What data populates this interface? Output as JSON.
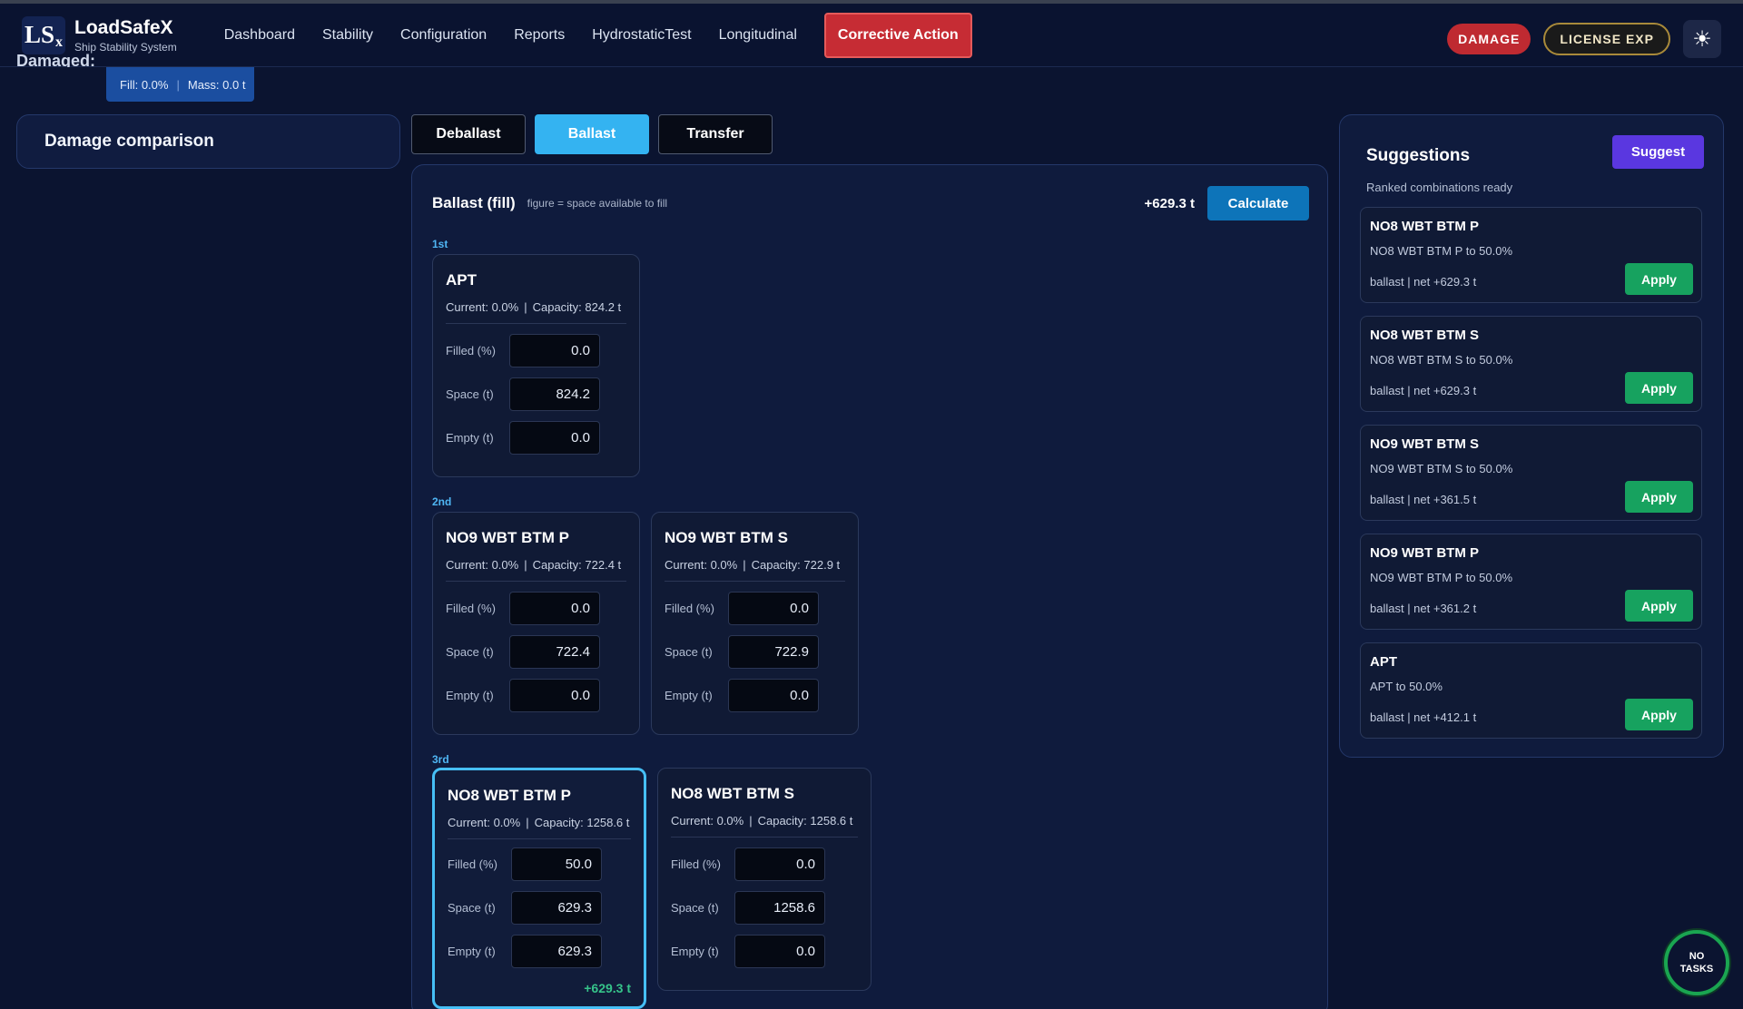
{
  "app": {
    "logo_mark": "LS",
    "logo_mark_x": "x",
    "name": "LoadSafeX",
    "subtitle": "Ship Stability System"
  },
  "nav": {
    "items": [
      "Dashboard",
      "Stability",
      "Configuration",
      "Reports",
      "HydrostaticTest",
      "Longitudinal"
    ],
    "active": "Corrective Action"
  },
  "top_right": {
    "damage_label": "DAMAGE",
    "license_label": "LICENSE EXP",
    "theme_icon": "sun-icon",
    "theme_glyph": "☀"
  },
  "damaged": {
    "label": "Damaged:",
    "fill": "Fill: 0.0%",
    "mass": "Mass: 0.0 t"
  },
  "left_panel": {
    "title": "Damage comparison"
  },
  "mode_tabs": [
    {
      "label": "Deballast",
      "active": false
    },
    {
      "label": "Ballast",
      "active": true
    },
    {
      "label": "Transfer",
      "active": false
    }
  ],
  "main": {
    "title": "Ballast (fill)",
    "hint": "figure = space available to fill",
    "net": "+629.3 t",
    "calculate_label": "Calculate"
  },
  "groups": [
    {
      "label": "1st",
      "tanks": [
        {
          "name": "APT",
          "current": "Current: 0.0%",
          "capacity": "Capacity: 824.2 t",
          "filled": "0.0",
          "space": "824.2",
          "empty": "0.0",
          "net": "",
          "selected": false
        }
      ]
    },
    {
      "label": "2nd",
      "tanks": [
        {
          "name": "NO9 WBT BTM P",
          "current": "Current: 0.0%",
          "capacity": "Capacity: 722.4 t",
          "filled": "0.0",
          "space": "722.4",
          "empty": "0.0",
          "net": "",
          "selected": false
        },
        {
          "name": "NO9 WBT BTM S",
          "current": "Current: 0.0%",
          "capacity": "Capacity: 722.9 t",
          "filled": "0.0",
          "space": "722.9",
          "empty": "0.0",
          "net": "",
          "selected": false
        }
      ]
    },
    {
      "label": "3rd",
      "tanks": [
        {
          "name": "NO8 WBT BTM P",
          "current": "Current: 0.0%",
          "capacity": "Capacity: 1258.6 t",
          "filled": "50.0",
          "space": "629.3",
          "empty": "629.3",
          "net": "+629.3 t",
          "selected": true
        },
        {
          "name": "NO8 WBT BTM S",
          "current": "Current: 0.0%",
          "capacity": "Capacity: 1258.6 t",
          "filled": "0.0",
          "space": "1258.6",
          "empty": "0.0",
          "net": "",
          "selected": false
        }
      ]
    }
  ],
  "field_labels": {
    "filled": "Filled (%)",
    "space": "Space (t)",
    "empty": "Empty (t)"
  },
  "suggestions": {
    "title": "Suggestions",
    "suggest_label": "Suggest",
    "status": "Ranked combinations ready",
    "apply_label": "Apply",
    "items": [
      {
        "name": "NO8 WBT BTM P",
        "desc": "NO8 WBT BTM P to 50.0%",
        "detail": "ballast | net +629.3 t"
      },
      {
        "name": "NO8 WBT BTM S",
        "desc": "NO8 WBT BTM S to 50.0%",
        "detail": "ballast | net +629.3 t"
      },
      {
        "name": "NO9 WBT BTM S",
        "desc": "NO9 WBT BTM S to 50.0%",
        "detail": "ballast | net +361.5 t"
      },
      {
        "name": "NO9 WBT BTM P",
        "desc": "NO9 WBT BTM P to 50.0%",
        "detail": "ballast | net +361.2 t"
      },
      {
        "name": "APT",
        "desc": "APT to 50.0%",
        "detail": "ballast | net +412.1 t"
      }
    ]
  },
  "tasks": {
    "line1": "NO",
    "line2": "TASKS"
  },
  "colors": {
    "background": "#0b1430",
    "accent_blue": "#34b3f1",
    "danger_red": "#c62c34",
    "apply_green": "#17a25f",
    "suggest_purple": "#5a37e0"
  }
}
